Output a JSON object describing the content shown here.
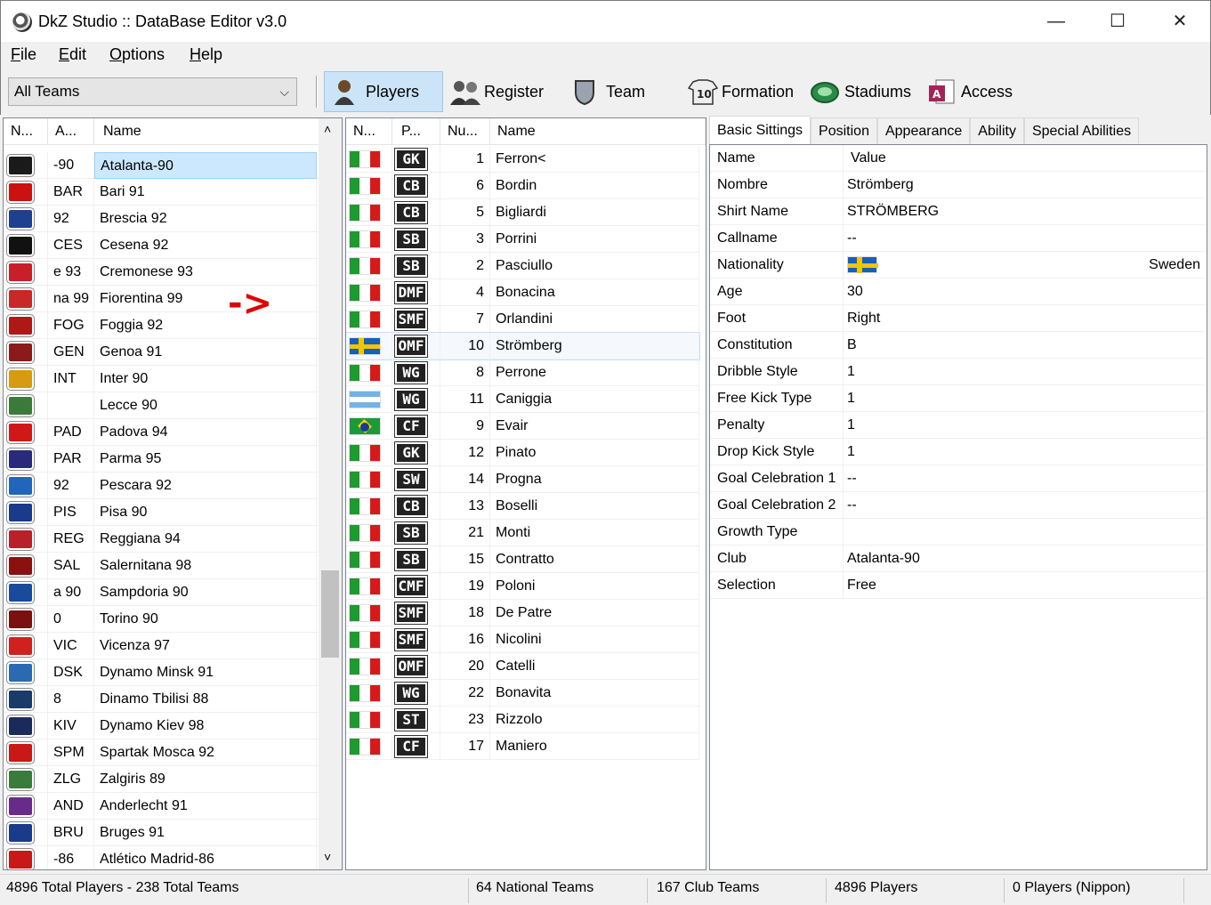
{
  "window": {
    "title": "DkZ Studio :: DataBase Editor v3.0",
    "min": "—",
    "max": "☐",
    "close": "✕"
  },
  "menu": [
    "File",
    "Edit",
    "Options",
    "Help"
  ],
  "toolbar": {
    "team_filter": "All Teams",
    "buttons": [
      "Players",
      "Register",
      "Team",
      "Formation",
      "Stadiums",
      "Access"
    ]
  },
  "teams": {
    "headers": [
      "N...",
      "A...",
      "Name"
    ],
    "rows": [
      {
        "abbr": "-90",
        "name": "Atalanta-90",
        "color": "#1a1a1a"
      },
      {
        "abbr": "BAR",
        "name": "Bari 91",
        "color": "#cc1111"
      },
      {
        "abbr": "92",
        "name": "Brescia 92",
        "color": "#1f3f8f"
      },
      {
        "abbr": "CES",
        "name": "Cesena 92",
        "color": "#111111"
      },
      {
        "abbr": "e 93",
        "name": "Cremonese 93",
        "color": "#c8202a"
      },
      {
        "abbr": "na 99",
        "name": "Fiorentina 99",
        "color": "#c82828"
      },
      {
        "abbr": "FOG",
        "name": "Foggia 92",
        "color": "#b01818"
      },
      {
        "abbr": "GEN",
        "name": "Genoa 91",
        "color": "#8b1a1a"
      },
      {
        "abbr": "INT",
        "name": "Inter 90",
        "color": "#d89a10"
      },
      {
        "abbr": "",
        "name": "Lecce 90",
        "color": "#3c7a3c"
      },
      {
        "abbr": "PAD",
        "name": "Padova 94",
        "color": "#d01818"
      },
      {
        "abbr": "PAR",
        "name": "Parma 95",
        "color": "#2a2a7a"
      },
      {
        "abbr": "92",
        "name": "Pescara 92",
        "color": "#2266bb"
      },
      {
        "abbr": "PIS",
        "name": "Pisa 90",
        "color": "#1a3a8a"
      },
      {
        "abbr": "REG",
        "name": "Reggiana 94",
        "color": "#b8202a"
      },
      {
        "abbr": "SAL",
        "name": "Salernitana 98",
        "color": "#8b1010"
      },
      {
        "abbr": "a 90",
        "name": "Sampdoria 90",
        "color": "#1a4a9a"
      },
      {
        "abbr": "0",
        "name": "Torino 90",
        "color": "#7a1010"
      },
      {
        "abbr": "VIC",
        "name": "Vicenza 97",
        "color": "#d02020"
      },
      {
        "abbr": "DSK",
        "name": "Dynamo Minsk 91",
        "color": "#2a6ab0"
      },
      {
        "abbr": "8",
        "name": "Dinamo Tbilisi 88",
        "color": "#1a3a6a"
      },
      {
        "abbr": "KIV",
        "name": "Dynamo Kiev 98",
        "color": "#1a2a5a"
      },
      {
        "abbr": "SPM",
        "name": "Spartak Mosca 92",
        "color": "#c81818"
      },
      {
        "abbr": "ZLG",
        "name": "Zalgiris 89",
        "color": "#3a7a3a"
      },
      {
        "abbr": "AND",
        "name": "Anderlecht 91",
        "color": "#6a2a8a"
      },
      {
        "abbr": "BRU",
        "name": "Bruges 91",
        "color": "#1a3a8a"
      },
      {
        "abbr": "-86",
        "name": "Atlético Madrid-86",
        "color": "#c81818"
      }
    ],
    "annotation_arrow": "->"
  },
  "players": {
    "headers": [
      "N...",
      "P...",
      "Nu...",
      "Name"
    ],
    "rows": [
      {
        "nation": "italy",
        "pos": "GK",
        "num": "1",
        "name": "Ferron<"
      },
      {
        "nation": "italy",
        "pos": "CB",
        "num": "6",
        "name": "Bordin"
      },
      {
        "nation": "italy",
        "pos": "CB",
        "num": "5",
        "name": "Bigliardi"
      },
      {
        "nation": "italy",
        "pos": "SB",
        "num": "3",
        "name": "Porrini"
      },
      {
        "nation": "italy",
        "pos": "SB",
        "num": "2",
        "name": "Pasciullo"
      },
      {
        "nation": "italy",
        "pos": "DMF",
        "num": "4",
        "name": "Bonacina"
      },
      {
        "nation": "italy",
        "pos": "SMF",
        "num": "7",
        "name": "Orlandini"
      },
      {
        "nation": "sweden",
        "pos": "OMF",
        "num": "10",
        "name": "Strömberg"
      },
      {
        "nation": "italy",
        "pos": "WG",
        "num": "8",
        "name": "Perrone"
      },
      {
        "nation": "argentina",
        "pos": "WG",
        "num": "11",
        "name": "Caniggia"
      },
      {
        "nation": "brazil",
        "pos": "CF",
        "num": "9",
        "name": "Evair"
      },
      {
        "nation": "italy",
        "pos": "GK",
        "num": "12",
        "name": "Pinato"
      },
      {
        "nation": "italy",
        "pos": "SW",
        "num": "14",
        "name": "Progna"
      },
      {
        "nation": "italy",
        "pos": "CB",
        "num": "13",
        "name": "Boselli"
      },
      {
        "nation": "italy",
        "pos": "SB",
        "num": "21",
        "name": "Monti"
      },
      {
        "nation": "italy",
        "pos": "SB",
        "num": "15",
        "name": "Contratto"
      },
      {
        "nation": "italy",
        "pos": "CMF",
        "num": "19",
        "name": "Poloni"
      },
      {
        "nation": "italy",
        "pos": "SMF",
        "num": "18",
        "name": "De Patre"
      },
      {
        "nation": "italy",
        "pos": "SMF",
        "num": "16",
        "name": "Nicolini"
      },
      {
        "nation": "italy",
        "pos": "OMF",
        "num": "20",
        "name": "Catelli"
      },
      {
        "nation": "italy",
        "pos": "WG",
        "num": "22",
        "name": "Bonavita"
      },
      {
        "nation": "italy",
        "pos": "ST",
        "num": "23",
        "name": "Rizzolo"
      },
      {
        "nation": "italy",
        "pos": "CF",
        "num": "17",
        "name": "Maniero"
      }
    ]
  },
  "details": {
    "tabs": [
      "Basic Sittings",
      "Position",
      "Appearance",
      "Ability",
      "Special Abilities"
    ],
    "header_key": "Name",
    "header_value": "Value",
    "rows": [
      {
        "key": "Nombre",
        "value": "Strömberg"
      },
      {
        "key": "Shirt Name",
        "value": "STRÖMBERG"
      },
      {
        "key": "Callname",
        "value": "--"
      },
      {
        "key": "Nationality",
        "value": "",
        "flag": "sweden",
        "extra": "Sweden"
      },
      {
        "key": "Age",
        "value": "30"
      },
      {
        "key": "Foot",
        "value": "Right"
      },
      {
        "key": "Constitution",
        "value": "B"
      },
      {
        "key": "Dribble Style",
        "value": "1"
      },
      {
        "key": "Free Kick Type",
        "value": "1"
      },
      {
        "key": "Penalty",
        "value": "1"
      },
      {
        "key": "Drop Kick Style",
        "value": "1"
      },
      {
        "key": "Goal Celebration 1",
        "value": "--"
      },
      {
        "key": "Goal Celebration 2",
        "value": "--"
      },
      {
        "key": "Growth Type",
        "value": ""
      },
      {
        "key": "Club",
        "value": "Atalanta-90"
      },
      {
        "key": "Selection",
        "value": "Free"
      }
    ]
  },
  "status": {
    "total": "4896 Total Players  -  238 Total Teams",
    "national": "64 National Teams",
    "club": "167 Club Teams",
    "players": "4896 Players",
    "nippon": "0 Players (Nippon)"
  }
}
